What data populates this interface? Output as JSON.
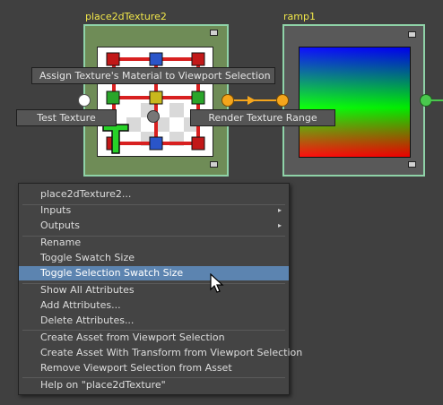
{
  "nodes": {
    "place2d": {
      "title": "place2dTexture2"
    },
    "ramp": {
      "title": "ramp1"
    }
  },
  "hotbox": {
    "assign": "Assign Texture's Material to Viewport Selection",
    "test": "Test Texture",
    "render_range": "Render Texture Range"
  },
  "menu": {
    "header": "place2dTexture2...",
    "inputs": "Inputs",
    "outputs": "Outputs",
    "rename": "Rename",
    "toggle_swatch": "Toggle Swatch Size",
    "toggle_selection_swatch": "Toggle Selection Swatch Size",
    "show_all": "Show All Attributes",
    "add_attrs": "Add Attributes...",
    "delete_attrs": "Delete Attributes...",
    "create_asset": "Create Asset from Viewport Selection",
    "create_asset_transform": "Create Asset With Transform from Viewport Selection",
    "remove_selection": "Remove Viewport Selection from Asset",
    "help": "Help on \"place2dTexture\"",
    "submenu_arrow": "▸"
  },
  "colors": {
    "accent": "#5c84b0",
    "wire": "#f4a51c",
    "node_border": "#8fd3a8",
    "title": "#f0e64a"
  }
}
